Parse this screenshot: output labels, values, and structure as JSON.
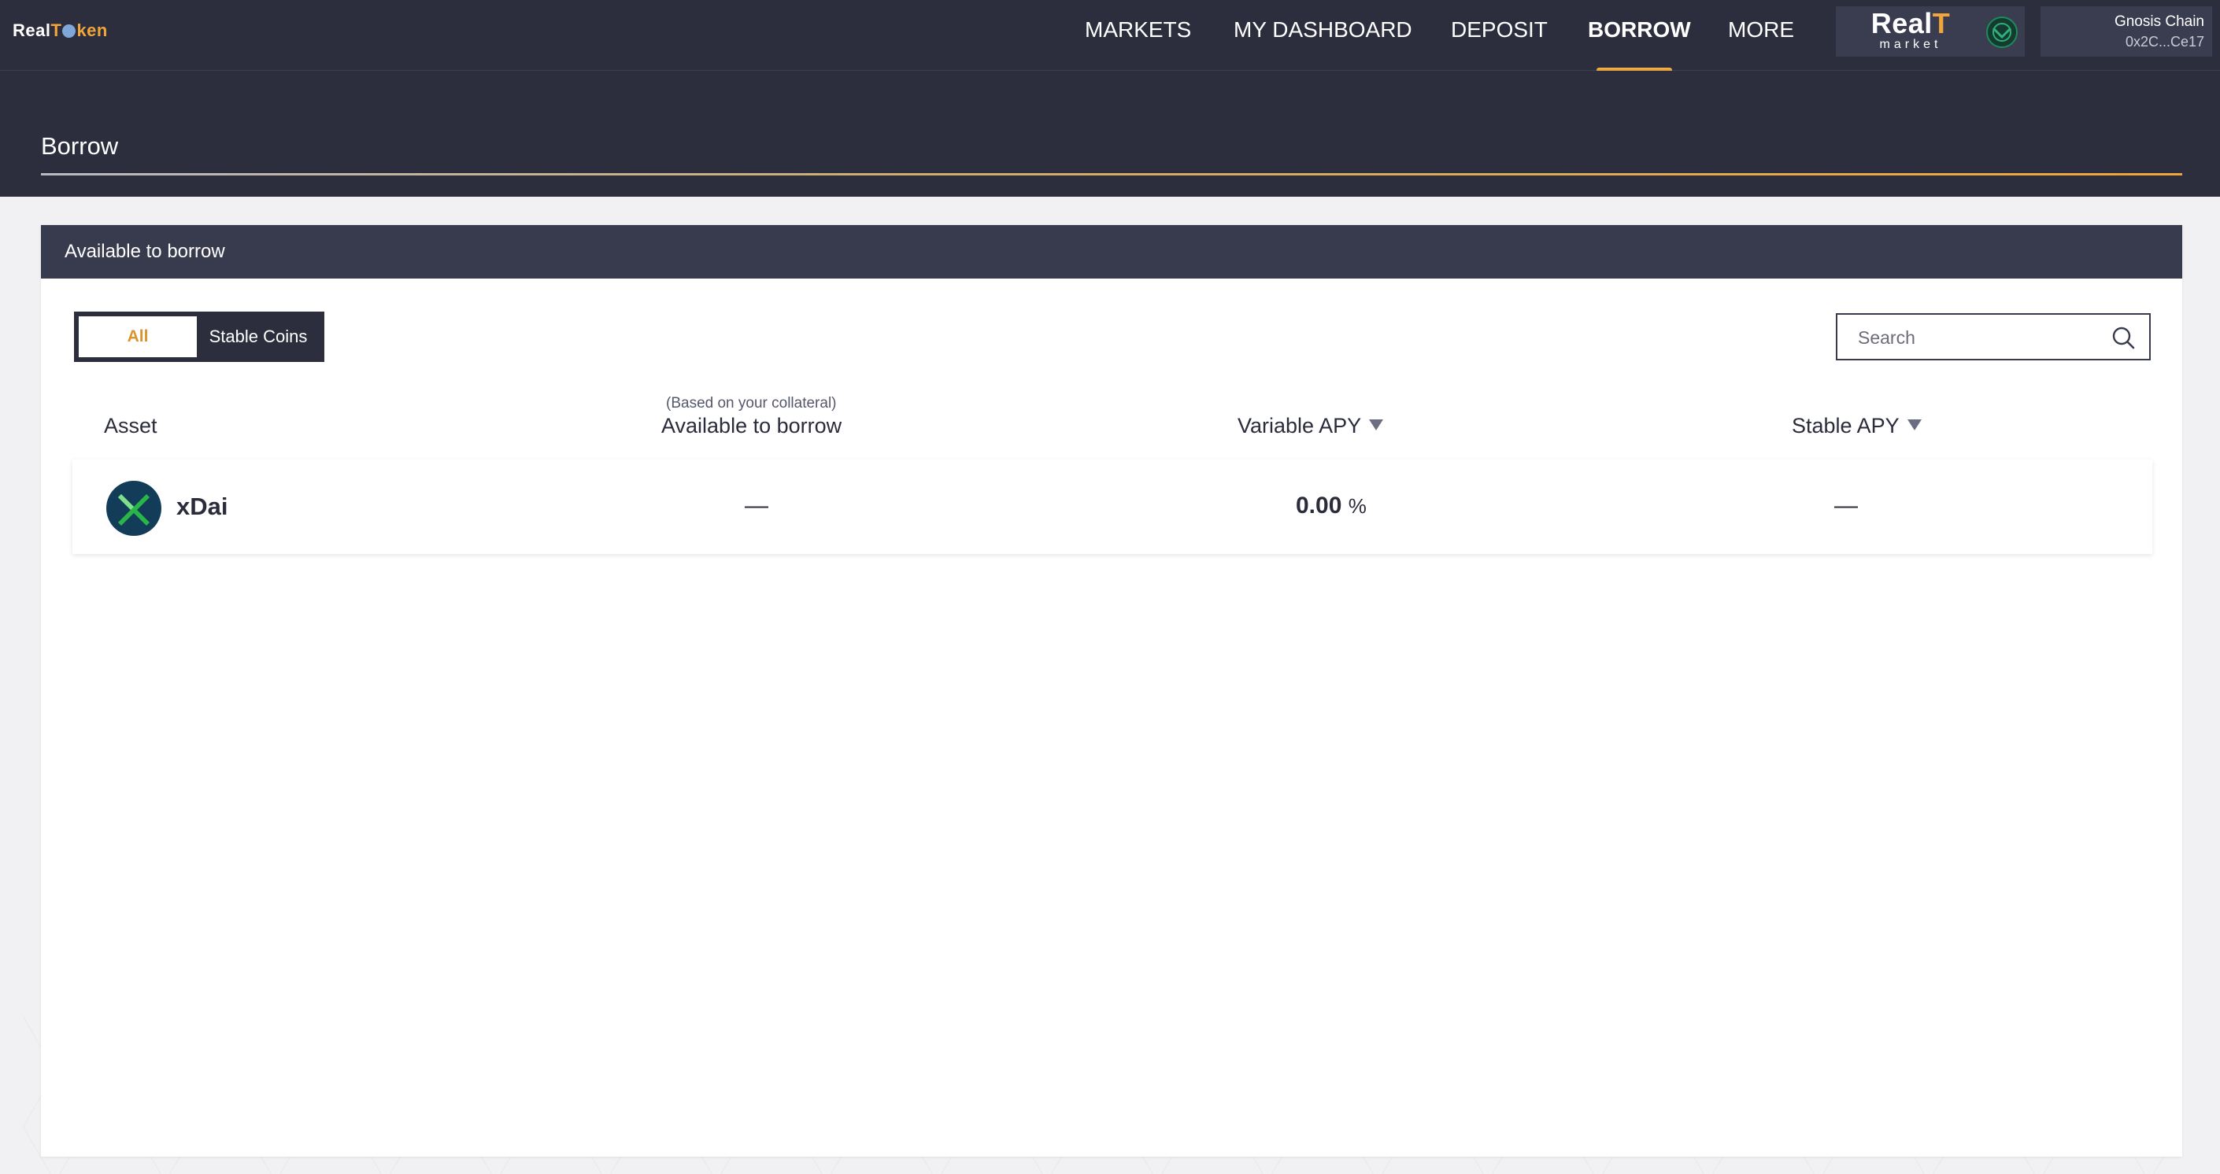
{
  "brand": {
    "name_part1": "Real",
    "name_part2": "T",
    "name_part3": "ken"
  },
  "nav": {
    "items": [
      {
        "label": "MARKETS"
      },
      {
        "label": "MY DASHBOARD"
      },
      {
        "label": "DEPOSIT"
      },
      {
        "label": "BORROW"
      },
      {
        "label": "MORE"
      }
    ],
    "active": "BORROW"
  },
  "market_badge": {
    "title_part1": "Real",
    "title_part2": "T",
    "subtitle": "market"
  },
  "wallet": {
    "network": "Gnosis Chain",
    "address": "0x2C...Ce17"
  },
  "page": {
    "title": "Borrow"
  },
  "card": {
    "header": "Available to borrow",
    "filters": {
      "all": "All",
      "stable": "Stable Coins"
    },
    "search": {
      "placeholder": "Search",
      "value": ""
    },
    "columns": {
      "asset": "Asset",
      "available_sub": "(Based on your collateral)",
      "available": "Available to borrow",
      "variable": "Variable APY",
      "stable": "Stable APY"
    },
    "rows": [
      {
        "asset": "xDai",
        "available": "—",
        "variable_apy": "0.00",
        "variable_unit": "%",
        "stable_apy": "—"
      }
    ]
  },
  "colors": {
    "accent": "#f0a63a",
    "header_bg": "#2c2e3d",
    "xdai_green": "#29b548",
    "xdai_bg": "#133c58"
  }
}
